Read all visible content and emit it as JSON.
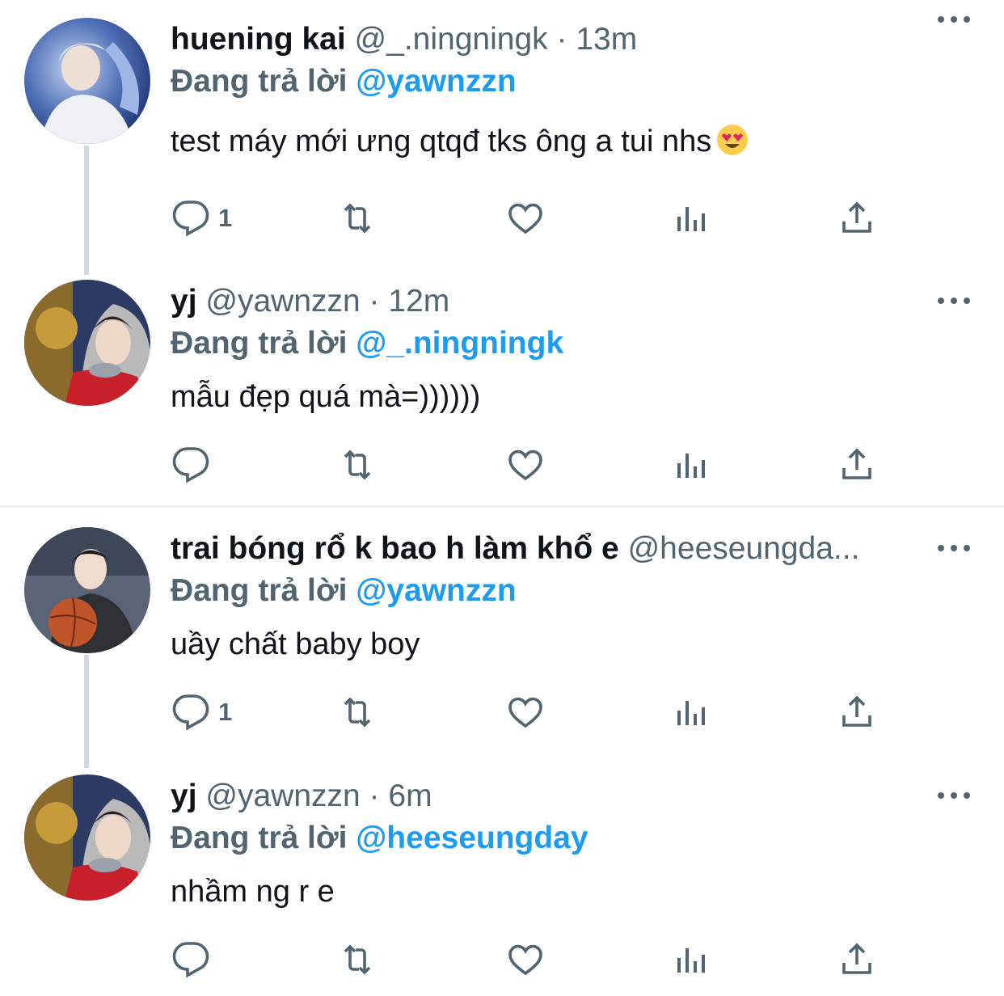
{
  "tweets": [
    {
      "name": "huening kai",
      "handle": "@_.ningningk",
      "sep": "·",
      "time": "13m",
      "reply_prefix": "Đang trả lời",
      "reply_to": "@yawnzzn",
      "text": "test máy mới ưng qtqđ tks ông a tui nhs",
      "emoji": "heart-eyes-emoji",
      "reply_count": "1"
    },
    {
      "name": "yj",
      "handle": "@yawnzzn",
      "sep": "·",
      "time": "12m",
      "reply_prefix": "Đang trả lời",
      "reply_to": "@_.ningningk",
      "text": "mẫu đẹp quá mà=))))))",
      "reply_count": ""
    },
    {
      "name": "trai bóng rổ k bao h làm khổ e",
      "handle": "@heeseungda...",
      "sep": "",
      "time": "",
      "reply_prefix": "Đang trả lời",
      "reply_to": "@yawnzzn",
      "text": "uầy chất baby boy",
      "reply_count": "1"
    },
    {
      "name": "yj",
      "handle": "@yawnzzn",
      "sep": "·",
      "time": "6m",
      "reply_prefix": "Đang trả lời",
      "reply_to": "@heeseungday",
      "text": "nhầm ng r e",
      "reply_count": ""
    }
  ],
  "icons": {
    "reply": "reply-icon",
    "retweet": "retweet-icon",
    "like": "heart-icon",
    "views": "analytics-icon",
    "share": "share-icon",
    "more": "more-icon"
  },
  "colors": {
    "text": "#0f1419",
    "secondary": "#536471",
    "link": "#1d9bf0",
    "thread_line": "#cfd9de",
    "divider": "#eff3f4"
  }
}
